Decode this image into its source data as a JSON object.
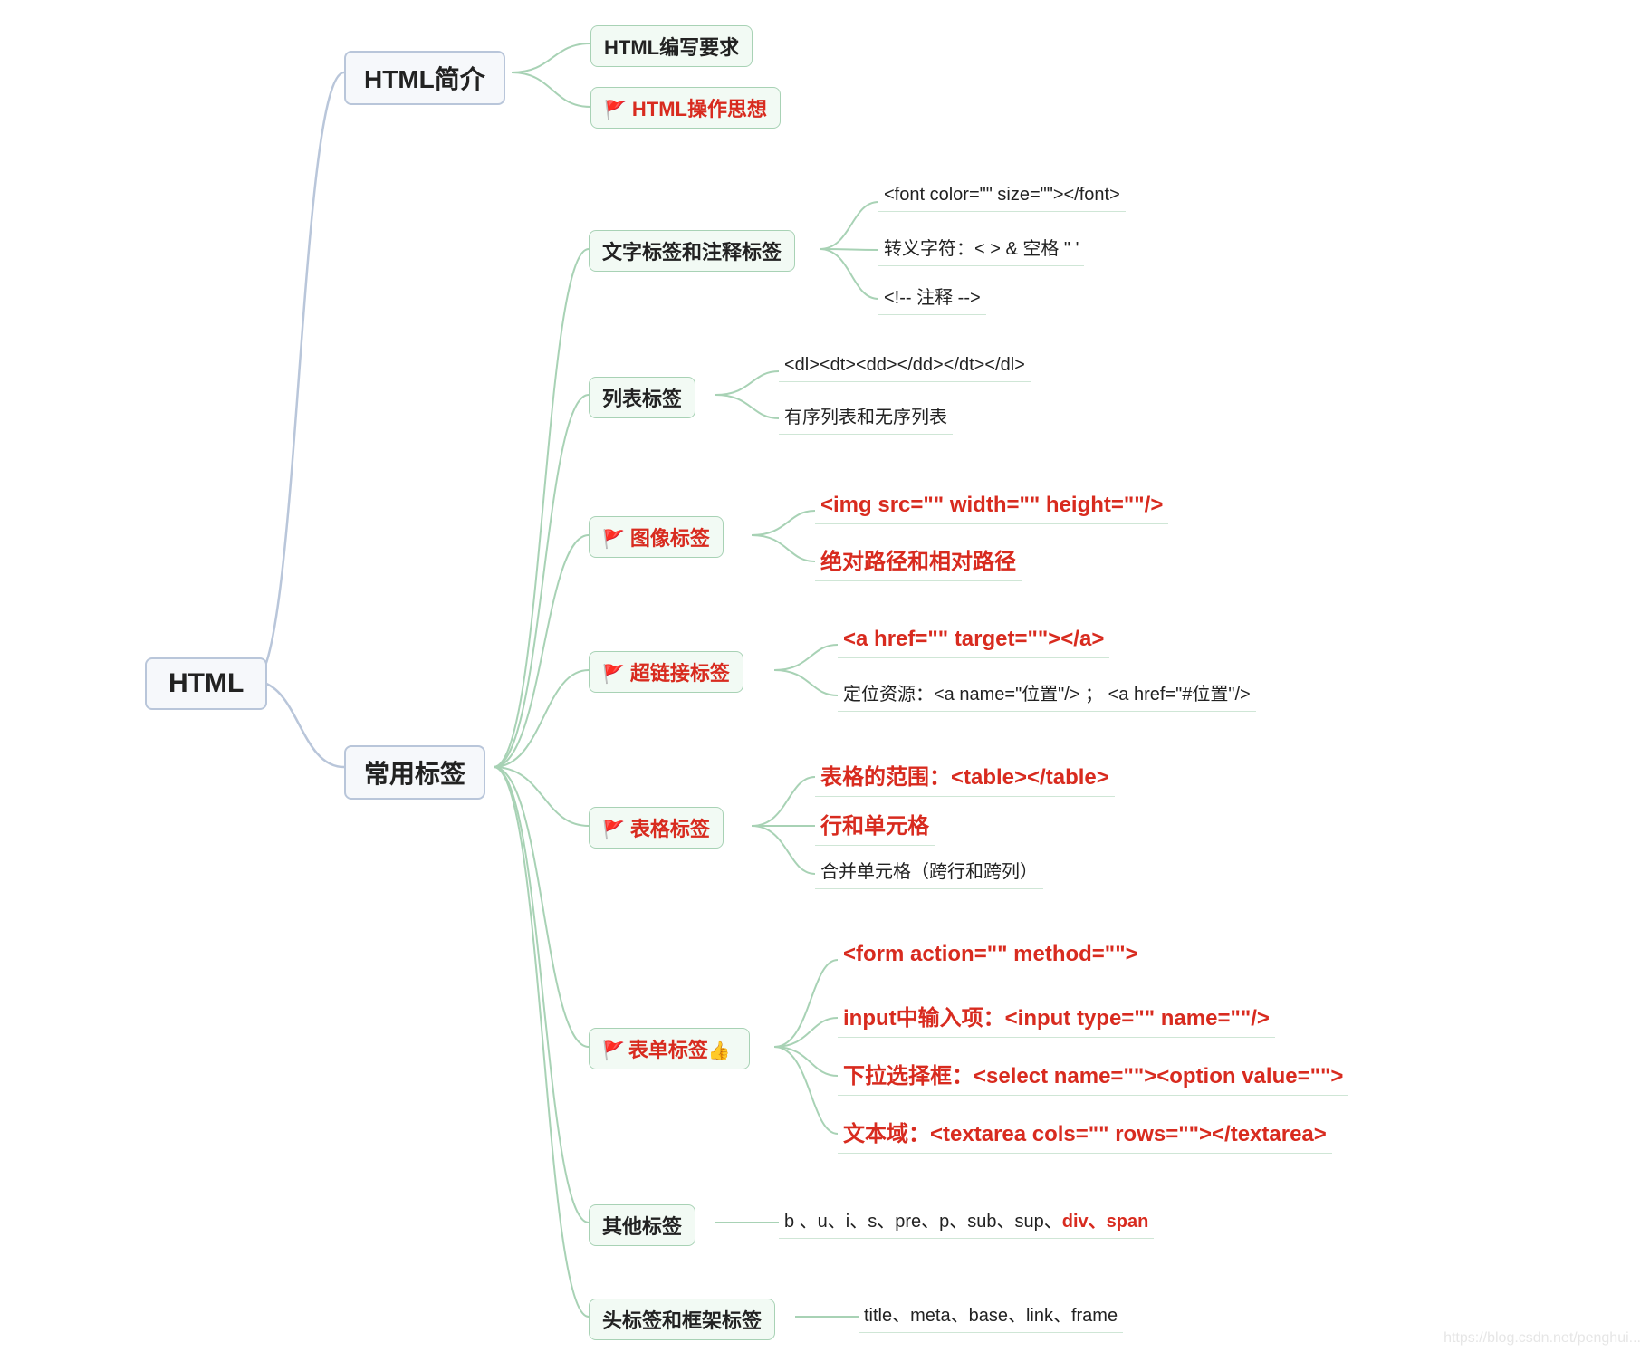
{
  "root": "HTML",
  "watermark": "https://blog.csdn.net/penghui...",
  "branches": [
    {
      "label": "HTML简介",
      "children": [
        {
          "label": "HTML编写要求",
          "type": "lvl3"
        },
        {
          "label": "HTML操作思想",
          "type": "lvl3",
          "red": true,
          "flag": true
        }
      ]
    },
    {
      "label": "常用标签",
      "children": [
        {
          "label": "文字标签和注释标签",
          "type": "lvl3",
          "leaves": [
            {
              "text": "<font color=\"\" size=\"\"></font>"
            },
            {
              "text": "转义字符：< > & 空格 \" '"
            },
            {
              "text": "<!-- 注释 -->"
            }
          ]
        },
        {
          "label": "列表标签",
          "type": "lvl3",
          "leaves": [
            {
              "text": "<dl><dt><dd></dd></dt></dl>"
            },
            {
              "text": "有序列表和无序列表"
            }
          ]
        },
        {
          "label": "图像标签",
          "type": "lvl3",
          "red": true,
          "flag": true,
          "leaves": [
            {
              "text": "<img src=\"\" width=\"\" height=\"\"/>",
              "red": true
            },
            {
              "text": "绝对路径和相对路径",
              "red": true
            }
          ]
        },
        {
          "label": "超链接标签",
          "type": "lvl3",
          "red": true,
          "flag": true,
          "leaves": [
            {
              "text": "<a href=\"\" target=\"\"></a>",
              "red": true
            },
            {
              "text": "定位资源：<a name=\"位置\"/> ； <a href=\"#位置\"/>"
            }
          ]
        },
        {
          "label": "表格标签",
          "type": "lvl3",
          "red": true,
          "flag": true,
          "leaves": [
            {
              "text": "表格的范围：<table></table>",
              "red": true
            },
            {
              "text": "行和单元格",
              "red": true
            },
            {
              "text": "合并单元格（跨行和跨列）"
            }
          ]
        },
        {
          "label": "表单标签",
          "type": "lvl3",
          "red": true,
          "thumb": true,
          "leaves": [
            {
              "text": "<form action=\"\" method=\"\">",
              "red": true
            },
            {
              "text": "input中输入项：<input type=\"\" name=\"\"/>",
              "red": true
            },
            {
              "text": "下拉选择框：<select name=\"\"><option value=\"\">",
              "red": true
            },
            {
              "text": "文本域：<textarea cols=\"\" rows=\"\"></textarea>",
              "red": true
            }
          ]
        },
        {
          "label": "其他标签",
          "type": "lvl3",
          "leaves": [
            {
              "text_parts": [
                {
                  "t": "b 、u、i、s、pre、p、sub、sup、"
                },
                {
                  "t": "div、span",
                  "red": true
                }
              ]
            }
          ]
        },
        {
          "label": "头标签和框架标签",
          "type": "lvl3",
          "leaves": [
            {
              "text": "title、meta、base、link、frame"
            }
          ]
        }
      ]
    }
  ]
}
